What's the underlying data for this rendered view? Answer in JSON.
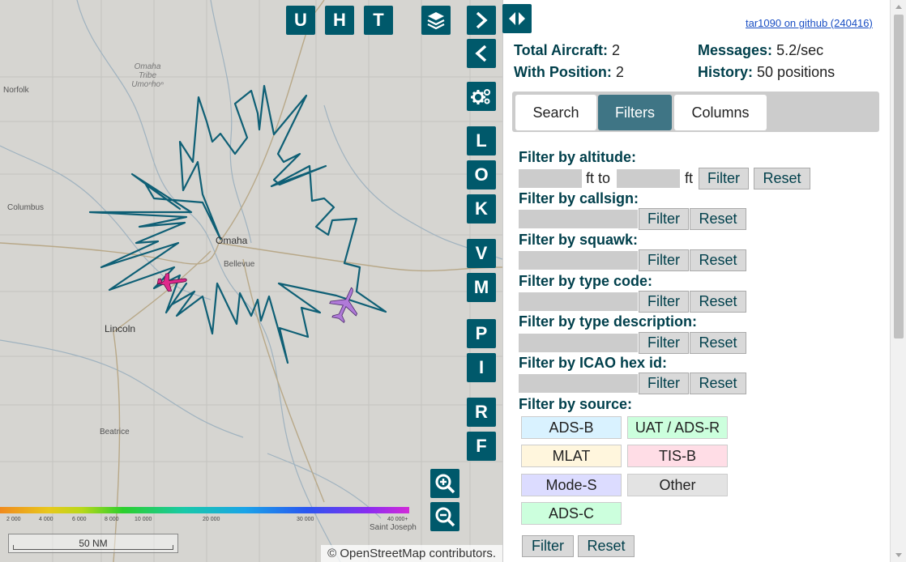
{
  "map": {
    "buttons": {
      "u": "U",
      "h": "H",
      "t": "T",
      "l": "L",
      "o": "O",
      "k": "K",
      "v": "V",
      "m": "M",
      "p": "P",
      "i": "I",
      "r": "R",
      "f": "F"
    },
    "labels": {
      "norfolk": "Norfolk",
      "omaha_tribe": "Omaha Tribe / Umoⁿhoⁿ",
      "columbus": "Columbus",
      "omaha": "Omaha",
      "bellevue": "Bellevue",
      "lincoln": "Lincoln",
      "beatrice": "Beatrice",
      "saint_joseph": "Saint Joseph"
    },
    "color_scale_ticks": [
      "2 000",
      "4 000",
      "6 000",
      "8 000",
      "10 000",
      "20 000",
      "30 000",
      "40 000+"
    ],
    "scale_line": "50 NM",
    "attribution": "© OpenStreetMap contributors.",
    "aircraft": [
      {
        "color": "#e0288c"
      },
      {
        "color": "#b07ad8"
      }
    ],
    "range_outline_color": "#0e5f75"
  },
  "sidebar": {
    "github_link": "tar1090 on github (240416)",
    "stats": {
      "total_aircraft_label": "Total Aircraft:",
      "total_aircraft": "2",
      "with_position_label": "With Position:",
      "with_position": "2",
      "messages_label": "Messages:",
      "messages": "5.2/sec",
      "history_label": "History:",
      "history": "50 positions"
    },
    "tabs": [
      "Search",
      "Filters",
      "Columns"
    ],
    "active_tab": "Filters",
    "filters": {
      "altitude": {
        "label": "Filter by altitude:",
        "ft_to": "ft to",
        "ft": "ft"
      },
      "callsign": {
        "label": "Filter by callsign:"
      },
      "squawk": {
        "label": "Filter by squawk:"
      },
      "type_code": {
        "label": "Filter by type code:"
      },
      "type_description": {
        "label": "Filter by type description:"
      },
      "icao": {
        "label": "Filter by ICAO hex id:"
      },
      "source": {
        "label": "Filter by source:"
      },
      "filter_btn": "Filter",
      "reset_btn": "Reset"
    },
    "sources": [
      {
        "label": "ADS-B",
        "color": "#d9f2ff"
      },
      {
        "label": "UAT / ADS-R",
        "color": "#ccffdd"
      },
      {
        "label": "MLAT",
        "color": "#fff6dd"
      },
      {
        "label": "TIS-B",
        "color": "#ffdde6"
      },
      {
        "label": "Mode-S",
        "color": "#dcdcff"
      },
      {
        "label": "Other",
        "color": "#e3e3e3"
      },
      {
        "label": "ADS-C",
        "color": "#ccffdd"
      }
    ]
  }
}
